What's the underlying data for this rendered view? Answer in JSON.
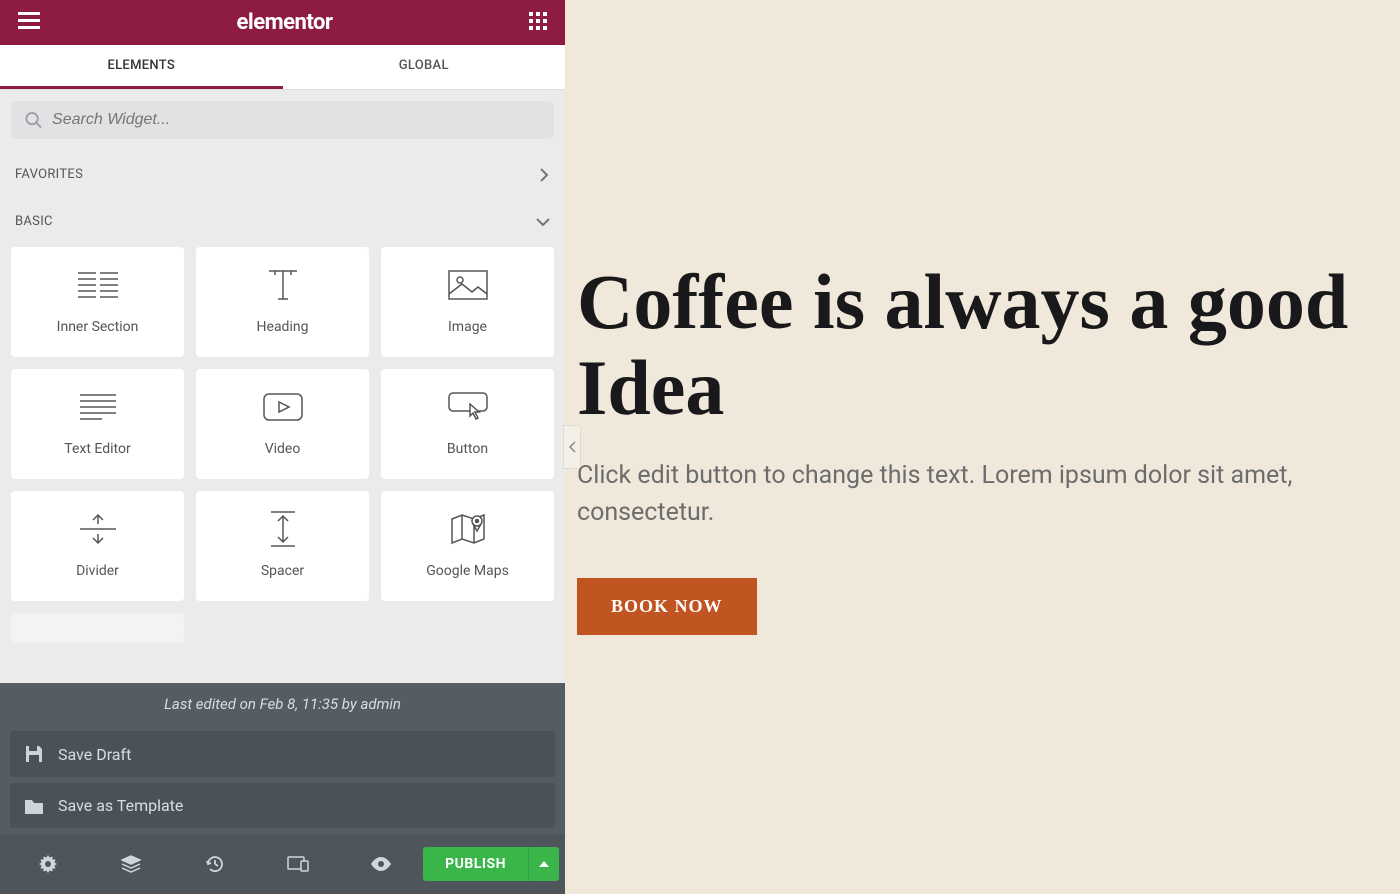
{
  "header": {
    "logo": "elementor"
  },
  "tabs": {
    "elements": "ELEMENTS",
    "global": "GLOBAL"
  },
  "search": {
    "placeholder": "Search Widget..."
  },
  "categories": {
    "favorites": "FAVORITES",
    "basic": "BASIC"
  },
  "widgets": [
    {
      "label": "Inner Section",
      "icon": "inner-section"
    },
    {
      "label": "Heading",
      "icon": "heading"
    },
    {
      "label": "Image",
      "icon": "image"
    },
    {
      "label": "Text Editor",
      "icon": "text-editor"
    },
    {
      "label": "Video",
      "icon": "video"
    },
    {
      "label": "Button",
      "icon": "button"
    },
    {
      "label": "Divider",
      "icon": "divider"
    },
    {
      "label": "Spacer",
      "icon": "spacer"
    },
    {
      "label": "Google Maps",
      "icon": "map"
    }
  ],
  "save": {
    "last_edited": "Last edited on Feb 8, 11:35 by admin",
    "draft": "Save Draft",
    "template": "Save as Template"
  },
  "publish": {
    "label": "PUBLISH"
  },
  "canvas": {
    "title": "Coffee is always a good Idea",
    "text": "Click edit button to change this text. Lorem ipsum dolor sit amet, consectetur.",
    "button": "BOOK NOW"
  },
  "colors": {
    "brand": "#8e1b42",
    "publish": "#39b54a",
    "cta": "#c15521",
    "canvas_bg": "#f0e9db"
  }
}
